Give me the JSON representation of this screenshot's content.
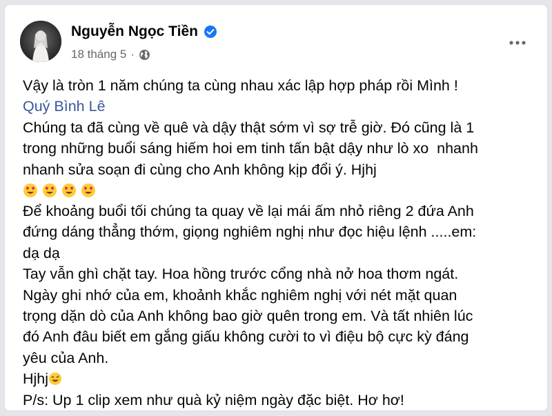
{
  "post": {
    "author": "Nguyễn Ngọc Tiền",
    "date": "18 tháng 5",
    "separator": "·",
    "lines": {
      "l1": "Vậy là tròn 1 năm chúng ta cùng nhau xác lập hợp pháp rồi Mình !",
      "mention": "Quý Bình Lê",
      "l3": "Chúng ta đã cùng về quê và dậy thật sớm vì sợ trễ giờ. Đó cũng là 1",
      "l4": "trong những buổi sáng hiếm hoi em tinh tấn bật dậy như lò xo  nhanh",
      "l5": "nhanh sửa soạn đi cùng cho Anh không kịp đổi ý. Hjhj",
      "l7": "Để khoảng buổi tối chúng ta quay về lại mái ấm nhỏ riêng 2 đứa Anh",
      "l8": "đứng dáng thẳng thớm, giọng nghiêm nghị như đọc hiệu lệnh .....em:",
      "l9": "dạ dạ",
      "l10": "Tay vẫn ghì chặt tay. Hoa hồng trước cổng nhà nở hoa thơm ngát.",
      "l11": "Ngày ghi nhớ của em, khoảnh khắc nghiêm nghị với nét mặt quan",
      "l12": "trọng dặn dò của Anh không bao giờ quên trong em. Và tất nhiên lúc",
      "l13": "đó Anh đâu biết em gắng giấu không cười to vì điệu bộ cực kỳ đáng",
      "l14": "yêu của Anh.",
      "l15": "Hjhj",
      "l16": "P/s: Up 1 clip xem như quà kỷ niệm ngày đặc biệt. Hơ hơ!"
    },
    "emojis": [
      "heart-eyes-emoji",
      "heart-eyes-emoji",
      "heart-eyes-emoji",
      "heart-eyes-emoji"
    ],
    "colors": {
      "mention": "#385898",
      "verified": "#1877f2",
      "meta": "#65676b"
    }
  }
}
